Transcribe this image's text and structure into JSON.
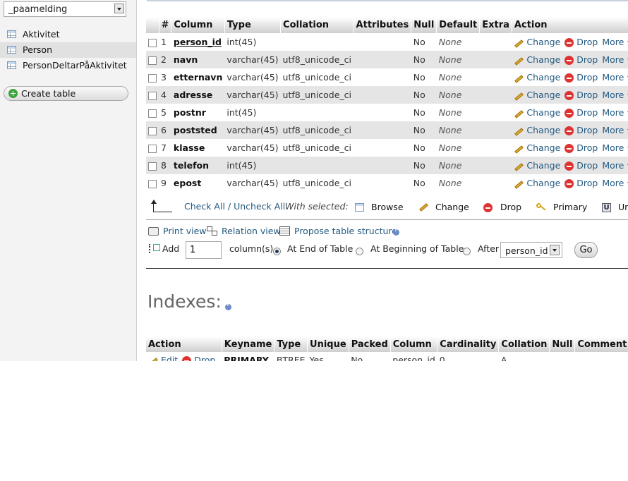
{
  "sidebar": {
    "database": "_paamelding",
    "tables": [
      {
        "name": "Aktivitet",
        "active": false
      },
      {
        "name": "Person",
        "active": true
      },
      {
        "name": "PersonDeltarPåAktivitet",
        "active": false
      }
    ],
    "create_table": "Create table"
  },
  "structure": {
    "headers": [
      "#",
      "Column",
      "Type",
      "Collation",
      "Attributes",
      "Null",
      "Default",
      "Extra",
      "Action"
    ],
    "rows": [
      {
        "n": "1",
        "column": "person_id",
        "type": "int(45)",
        "collation": "",
        "attributes": "",
        "null": "No",
        "default": "None",
        "extra": "",
        "pk": true
      },
      {
        "n": "2",
        "column": "navn",
        "type": "varchar(45)",
        "collation": "utf8_unicode_ci",
        "attributes": "",
        "null": "No",
        "default": "None",
        "extra": ""
      },
      {
        "n": "3",
        "column": "etternavn",
        "type": "varchar(45)",
        "collation": "utf8_unicode_ci",
        "attributes": "",
        "null": "No",
        "default": "None",
        "extra": ""
      },
      {
        "n": "4",
        "column": "adresse",
        "type": "varchar(45)",
        "collation": "utf8_unicode_ci",
        "attributes": "",
        "null": "No",
        "default": "None",
        "extra": ""
      },
      {
        "n": "5",
        "column": "postnr",
        "type": "int(45)",
        "collation": "",
        "attributes": "",
        "null": "No",
        "default": "None",
        "extra": ""
      },
      {
        "n": "6",
        "column": "poststed",
        "type": "varchar(45)",
        "collation": "utf8_unicode_ci",
        "attributes": "",
        "null": "No",
        "default": "None",
        "extra": ""
      },
      {
        "n": "7",
        "column": "klasse",
        "type": "varchar(45)",
        "collation": "utf8_unicode_ci",
        "attributes": "",
        "null": "No",
        "default": "None",
        "extra": ""
      },
      {
        "n": "8",
        "column": "telefon",
        "type": "int(45)",
        "collation": "",
        "attributes": "",
        "null": "No",
        "default": "None",
        "extra": ""
      },
      {
        "n": "9",
        "column": "epost",
        "type": "varchar(45)",
        "collation": "utf8_unicode_ci",
        "attributes": "",
        "null": "No",
        "default": "None",
        "extra": ""
      }
    ],
    "actions": {
      "change": "Change",
      "drop": "Drop",
      "more": "More"
    }
  },
  "with_selected": {
    "check_all": "Check All / Uncheck All",
    "label": "With selected:",
    "browse": "Browse",
    "change": "Change",
    "drop": "Drop",
    "primary": "Primary",
    "unique_partial": "Ur"
  },
  "views": {
    "print": "Print view",
    "relation": "Relation view",
    "propose": "Propose table structure"
  },
  "add_columns": {
    "add": "Add",
    "count": "1",
    "columns_label": "column(s)",
    "at_end": "At End of Table",
    "at_beginning": "At Beginning of Table",
    "after": "After",
    "after_column": "person_id",
    "go": "Go"
  },
  "indexes": {
    "title": "Indexes:",
    "headers": [
      "Action",
      "Keyname",
      "Type",
      "Unique",
      "Packed",
      "Column",
      "Cardinality",
      "Collation",
      "Null",
      "Comment"
    ],
    "row": {
      "edit": "Edit",
      "drop": "Drop",
      "keyname": "PRIMARY",
      "type": "BTREE",
      "unique": "Yes",
      "packed": "No",
      "column": "person_id",
      "cardinality": "0",
      "collation": "A",
      "null": "",
      "comment": ""
    }
  }
}
